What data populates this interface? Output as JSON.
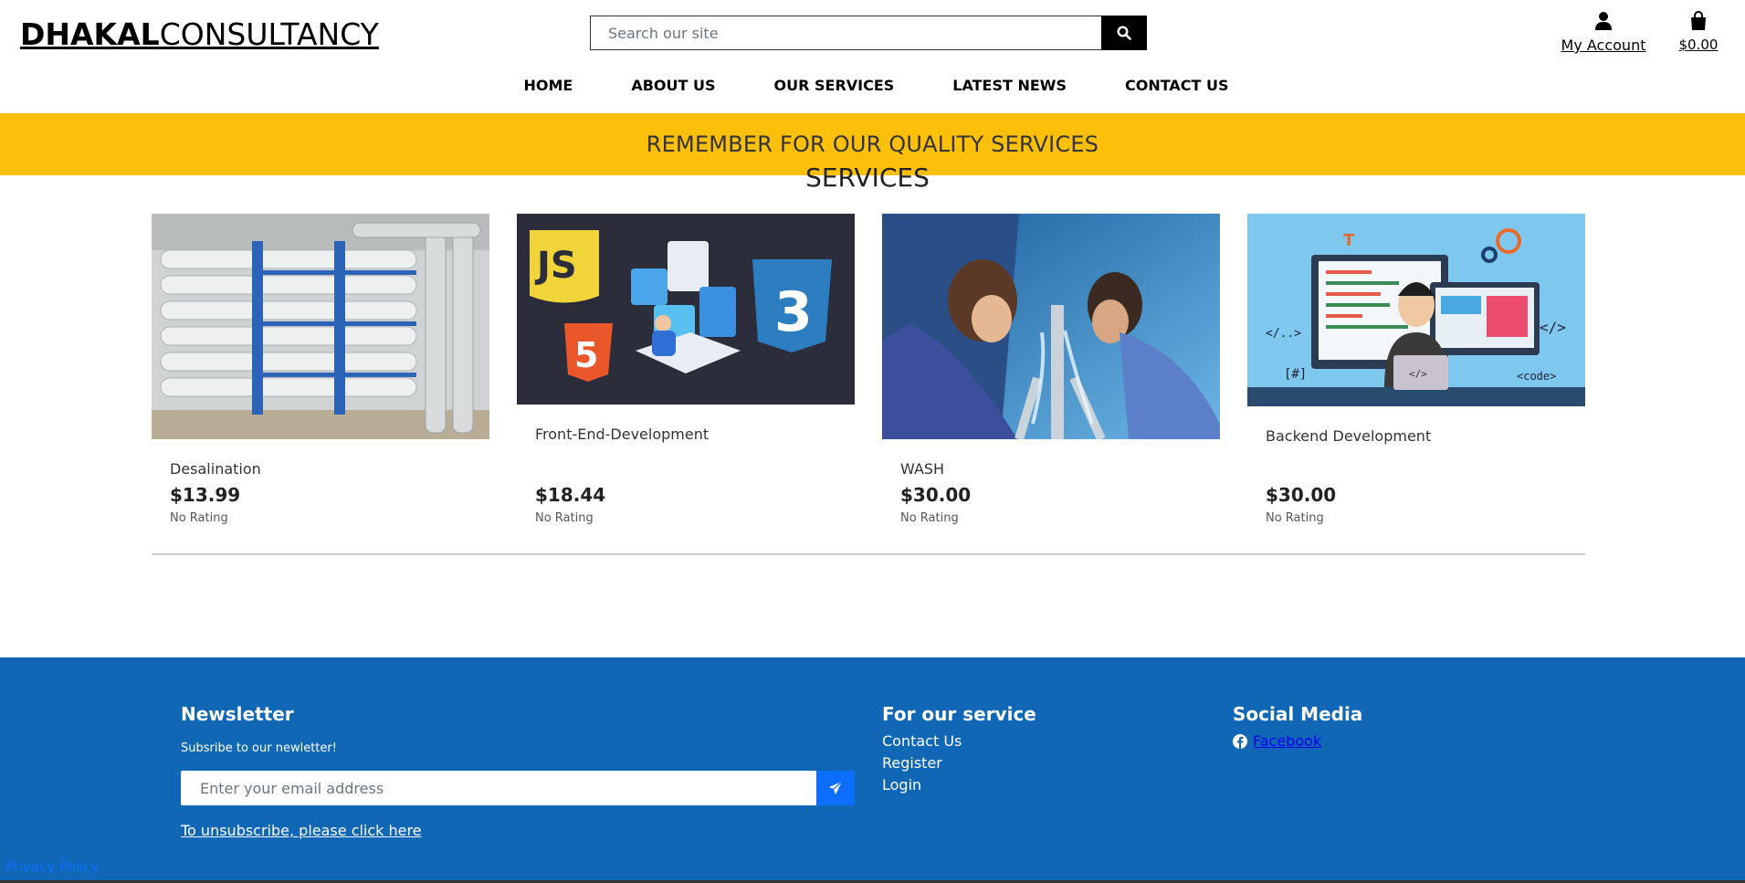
{
  "header": {
    "logo_bold": "DHAKAL",
    "logo_light": "CONSULTANCY",
    "search": {
      "placeholder": "Search our site"
    },
    "account_label": "My Account",
    "bag_total": "$0.00"
  },
  "nav": {
    "items": [
      {
        "label": "HOME"
      },
      {
        "label": "ABOUT US"
      },
      {
        "label": "OUR SERVICES"
      },
      {
        "label": "LATEST NEWS"
      },
      {
        "label": "CONTACT US"
      }
    ]
  },
  "banner": {
    "text": "REMEMBER FOR OUR QUALITY SERVICES"
  },
  "services": {
    "title": "SERVICES",
    "products": [
      {
        "name": "Desalination",
        "price": "$13.99",
        "rating": "No Rating"
      },
      {
        "name": "Front-End-Development",
        "price": "$18.44",
        "rating": "No Rating"
      },
      {
        "name": "WASH",
        "price": "$30.00",
        "rating": "No Rating"
      },
      {
        "name": "Backend Development",
        "price": "$30.00",
        "rating": "No Rating"
      }
    ]
  },
  "footer": {
    "newsletter": {
      "heading": "Newsletter",
      "subtitle": "Subsribe to our newletter!",
      "email_placeholder": "Enter your email address",
      "unsubscribe": "To unsubscribe, please click here"
    },
    "service": {
      "heading": "For our service",
      "links": [
        "Contact Us",
        "Register",
        "Login"
      ]
    },
    "social": {
      "heading": "Social Media",
      "facebook": "Facebook"
    },
    "privacy": "Privacy Policy"
  },
  "colors": {
    "banner": "#fcc00a",
    "footer": "#0f67b5",
    "accent": "#0d6efd"
  },
  "icons": [
    "search-icon",
    "user-icon",
    "shopping-bag-icon",
    "paper-plane-icon",
    "facebook-icon"
  ]
}
